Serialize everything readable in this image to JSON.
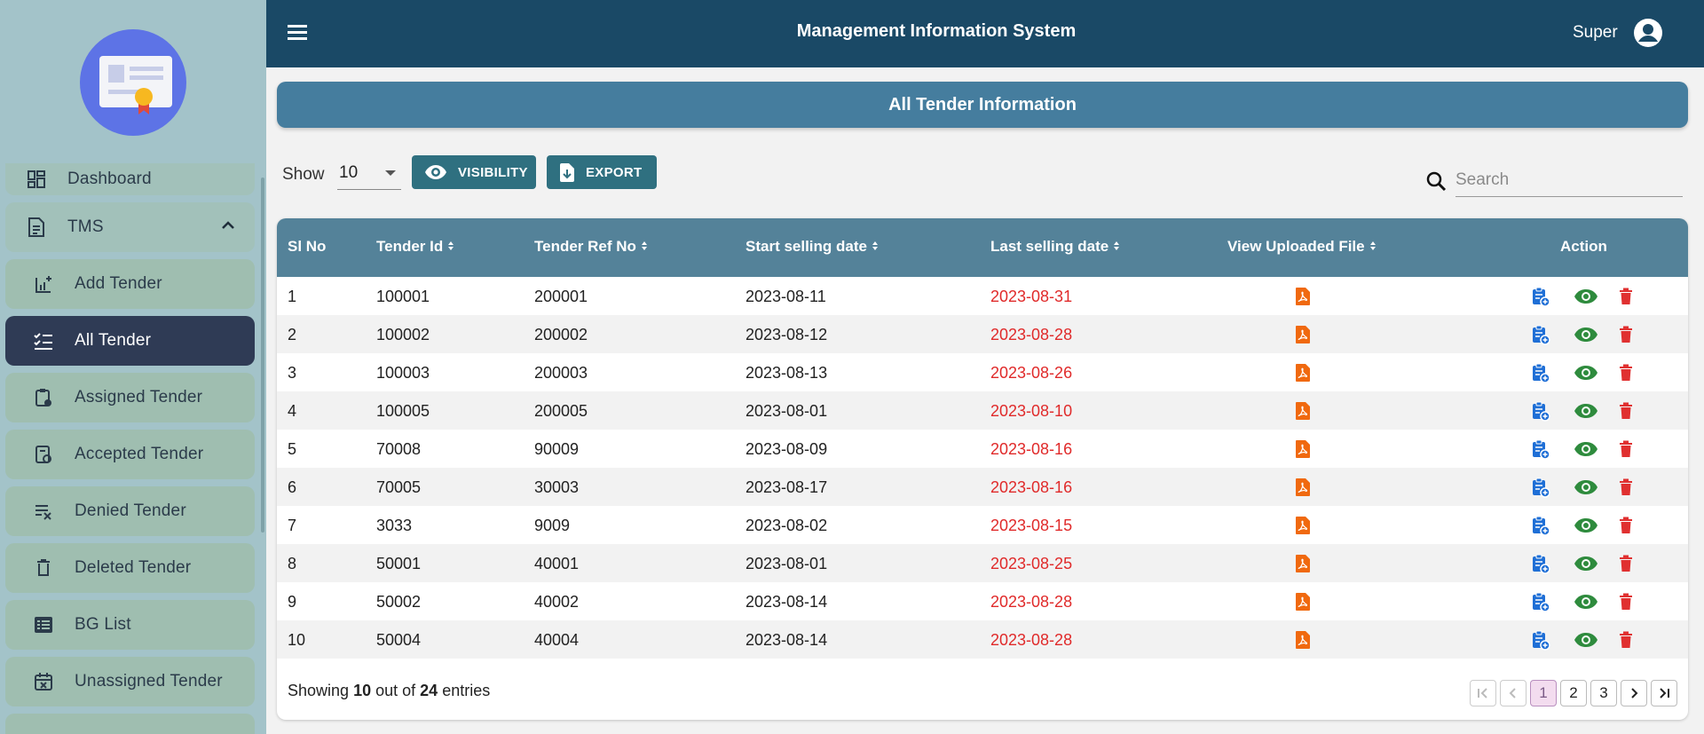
{
  "header": {
    "title": "Management Information System",
    "user_name": "Super"
  },
  "sidebar": {
    "items": [
      {
        "label": "Dashboard",
        "icon": "dashboard-icon"
      },
      {
        "label": "TMS",
        "icon": "document-icon"
      },
      {
        "label": "Add Tender",
        "icon": "add-chart-icon"
      },
      {
        "label": "All Tender",
        "icon": "checklist-icon",
        "active": true
      },
      {
        "label": "Assigned Tender",
        "icon": "assigned-icon"
      },
      {
        "label": "Accepted Tender",
        "icon": "accepted-icon"
      },
      {
        "label": "Denied Tender",
        "icon": "denied-icon"
      },
      {
        "label": "Deleted Tender",
        "icon": "trash-icon"
      },
      {
        "label": "BG List",
        "icon": "list-icon"
      },
      {
        "label": "Unassigned Tender",
        "icon": "calendar-x-icon"
      }
    ]
  },
  "page": {
    "title": "All Tender Information"
  },
  "controls": {
    "show_label": "Show",
    "show_value": "10",
    "visibility_label": "VISIBILITY",
    "export_label": "EXPORT",
    "search_placeholder": "Search"
  },
  "table": {
    "columns": [
      "Sl No",
      "Tender Id",
      "Tender Ref No",
      "Start selling date",
      "Last selling date",
      "View Uploaded File",
      "Action"
    ],
    "rows": [
      {
        "sl": "1",
        "tender_id": "100001",
        "ref_no": "200001",
        "start": "2023-08-11",
        "last": "2023-08-31"
      },
      {
        "sl": "2",
        "tender_id": "100002",
        "ref_no": "200002",
        "start": "2023-08-12",
        "last": "2023-08-28"
      },
      {
        "sl": "3",
        "tender_id": "100003",
        "ref_no": "200003",
        "start": "2023-08-13",
        "last": "2023-08-26"
      },
      {
        "sl": "4",
        "tender_id": "100005",
        "ref_no": "200005",
        "start": "2023-08-01",
        "last": "2023-08-10"
      },
      {
        "sl": "5",
        "tender_id": "70008",
        "ref_no": "90009",
        "start": "2023-08-09",
        "last": "2023-08-16"
      },
      {
        "sl": "6",
        "tender_id": "70005",
        "ref_no": "30003",
        "start": "2023-08-17",
        "last": "2023-08-16"
      },
      {
        "sl": "7",
        "tender_id": "3033",
        "ref_no": "9009",
        "start": "2023-08-02",
        "last": "2023-08-15"
      },
      {
        "sl": "8",
        "tender_id": "50001",
        "ref_no": "40001",
        "start": "2023-08-01",
        "last": "2023-08-25"
      },
      {
        "sl": "9",
        "tender_id": "50002",
        "ref_no": "40002",
        "start": "2023-08-14",
        "last": "2023-08-28"
      },
      {
        "sl": "10",
        "tender_id": "50004",
        "ref_no": "40004",
        "start": "2023-08-14",
        "last": "2023-08-28"
      }
    ]
  },
  "footer": {
    "showing_prefix": "Showing",
    "shown_count": "10",
    "out_of": "out of",
    "total": "24",
    "entries": "entries"
  },
  "pagination": {
    "pages": [
      "1",
      "2",
      "3"
    ],
    "current": "1"
  },
  "colors": {
    "header_bg": "#1a4966",
    "sidebar_bg": "#a3c3c9",
    "active_item": "#2f3b55",
    "table_header": "#548299",
    "date_red": "#e02a2a",
    "pdf_orange": "#f0690f",
    "assign_blue": "#1f6fd6",
    "view_green": "#2e8b3d",
    "delete_red": "#e03030"
  }
}
